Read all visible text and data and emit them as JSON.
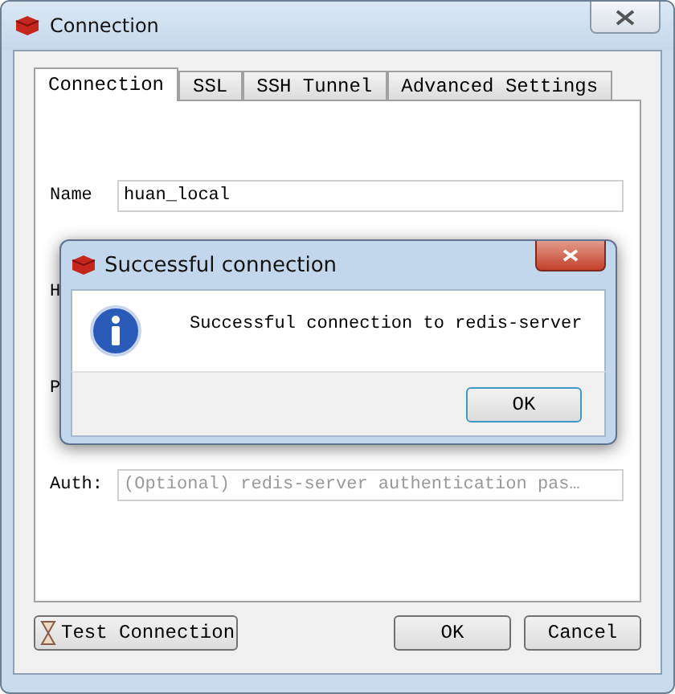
{
  "window": {
    "title": "Connection"
  },
  "tabs": [
    {
      "label": "Connection",
      "selected": true
    },
    {
      "label": "SSL",
      "selected": false
    },
    {
      "label": "SSH Tunnel",
      "selected": false
    },
    {
      "label": "Advanced Settings",
      "selected": false
    }
  ],
  "fields": [
    {
      "label": "Name",
      "value": "huan_local"
    },
    {
      "label": "H"
    },
    {
      "label": "P"
    },
    {
      "label": "Auth:",
      "placeholder": "(Optional) redis-server authentication pas…"
    }
  ],
  "buttons": {
    "test": "Test Connection",
    "ok": "OK",
    "cancel": "Cancel"
  },
  "message_box": {
    "title": "Successful connection",
    "message": "Successful connection to redis-server",
    "button": "OK"
  }
}
